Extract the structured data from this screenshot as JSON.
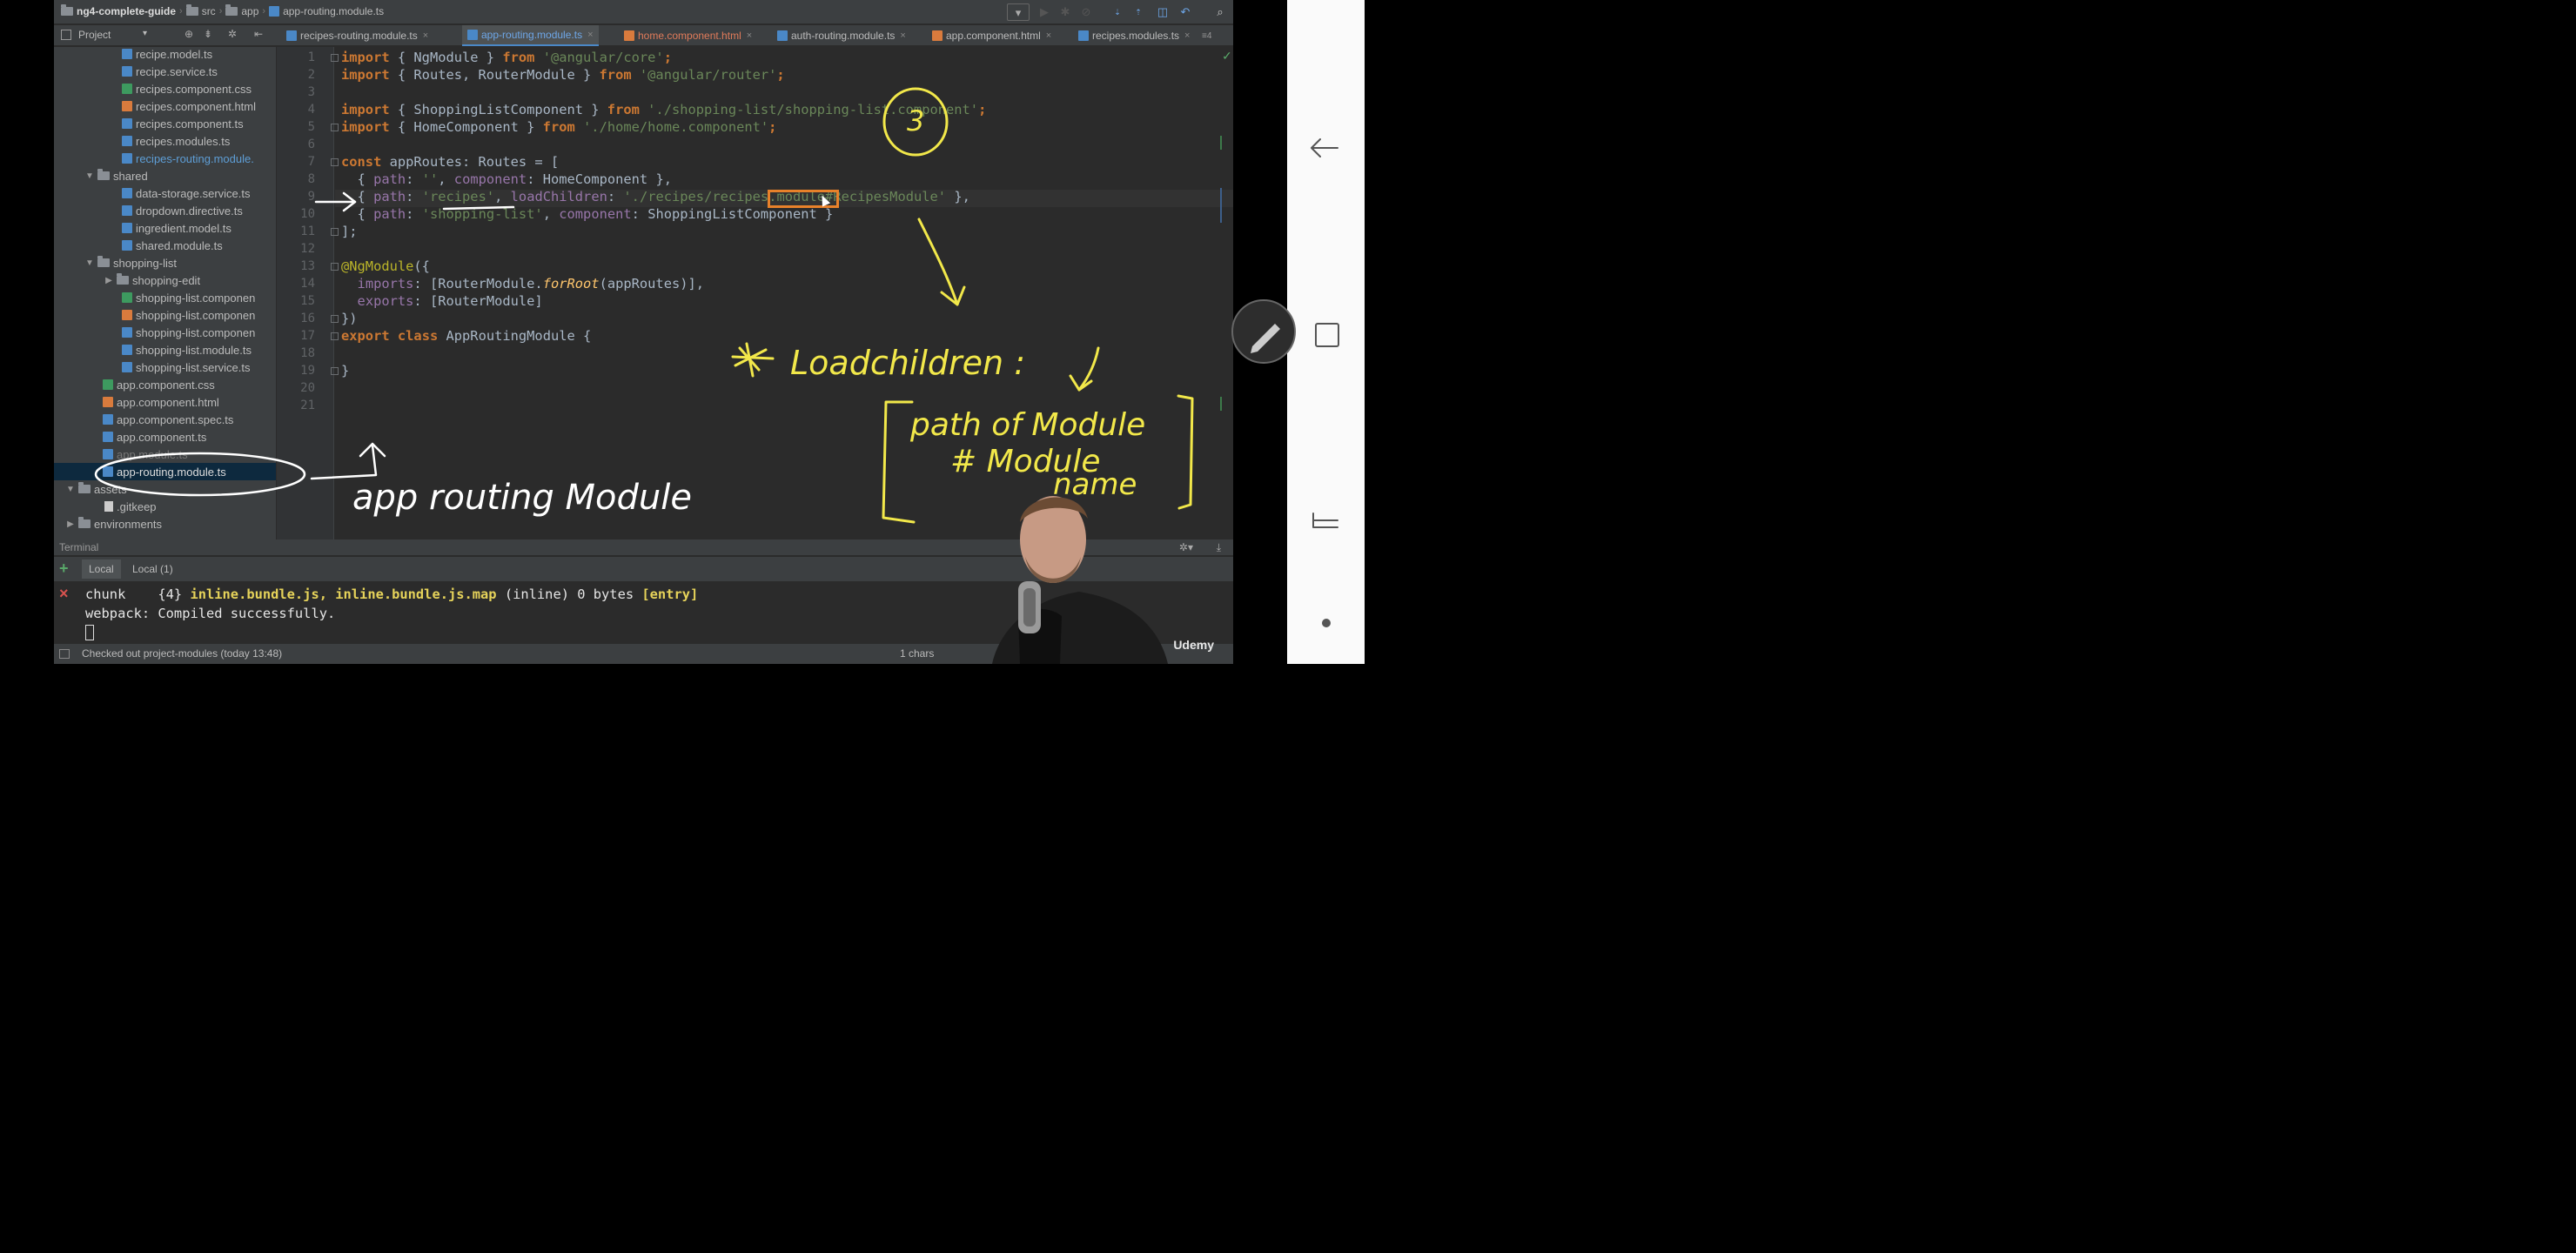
{
  "breadcrumbs": [
    "ng4-complete-guide",
    "src",
    "app",
    "app-routing.module.ts"
  ],
  "project_toolbar": {
    "label": "Project"
  },
  "tabs": [
    {
      "label": "recipes-routing.module.ts",
      "type": "ts"
    },
    {
      "label": "app-routing.module.ts",
      "type": "ts",
      "active": true
    },
    {
      "label": "home.component.html",
      "type": "html"
    },
    {
      "label": "auth-routing.module.ts",
      "type": "ts"
    },
    {
      "label": "app.component.html",
      "type": "html"
    },
    {
      "label": "recipes.modules.ts",
      "type": "ts"
    }
  ],
  "tabs_overflow": "≡4",
  "tree": [
    {
      "label": "recipe.model.ts",
      "type": "ts"
    },
    {
      "label": "recipe.service.ts",
      "type": "ts"
    },
    {
      "label": "recipes.component.css",
      "type": "css"
    },
    {
      "label": "recipes.component.html",
      "type": "html"
    },
    {
      "label": "recipes.component.ts",
      "type": "ts"
    },
    {
      "label": "recipes.modules.ts",
      "type": "ts"
    },
    {
      "label": "recipes-routing.module.",
      "type": "ts"
    },
    {
      "label": "shared",
      "type": "folder"
    },
    {
      "label": "data-storage.service.ts",
      "type": "ts"
    },
    {
      "label": "dropdown.directive.ts",
      "type": "ts"
    },
    {
      "label": "ingredient.model.ts",
      "type": "ts"
    },
    {
      "label": "shared.module.ts",
      "type": "ts"
    },
    {
      "label": "shopping-list",
      "type": "folder"
    },
    {
      "label": "shopping-edit",
      "type": "folder"
    },
    {
      "label": "shopping-list.componen",
      "type": "css"
    },
    {
      "label": "shopping-list.componen",
      "type": "html"
    },
    {
      "label": "shopping-list.componen",
      "type": "ts"
    },
    {
      "label": "shopping-list.module.ts",
      "type": "ts"
    },
    {
      "label": "shopping-list.service.ts",
      "type": "ts"
    },
    {
      "label": "app.component.css",
      "type": "css"
    },
    {
      "label": "app.component.html",
      "type": "html"
    },
    {
      "label": "app.component.spec.ts",
      "type": "ts"
    },
    {
      "label": "app.component.ts",
      "type": "ts"
    },
    {
      "label": "app.module.ts",
      "type": "ts"
    },
    {
      "label": "app-routing.module.ts",
      "type": "ts"
    },
    {
      "label": "assets",
      "type": "folder"
    },
    {
      "label": ".gitkeep",
      "type": "file"
    },
    {
      "label": "environments",
      "type": "folder"
    }
  ],
  "code": {
    "line_numbers": [
      "1",
      "2",
      "3",
      "4",
      "5",
      "6",
      "7",
      "8",
      "9",
      "10",
      "11",
      "12",
      "13",
      "14",
      "15",
      "16",
      "17",
      "18",
      "19",
      "20",
      "21"
    ],
    "l1": [
      "import",
      " { NgModule } ",
      "from",
      " ",
      "'@angular/core'",
      ";"
    ],
    "l2": [
      "import",
      " { Routes, RouterModule } ",
      "from",
      " ",
      "'@angular/router'",
      ";"
    ],
    "l4": [
      "import",
      " { ShoppingListComponent } ",
      "from",
      " ",
      "'./shopping-list/shopping-list.component'",
      ";"
    ],
    "l5": [
      "import",
      " { HomeComponent } ",
      "from",
      " ",
      "'./home/home.component'",
      ";"
    ],
    "l7": [
      "const",
      " appRoutes: Routes = ["
    ],
    "l8": [
      "  { ",
      "path",
      ": ",
      "''",
      ", ",
      "component",
      ": HomeComponent },"
    ],
    "l9": [
      "  { ",
      "path",
      ": ",
      "'recipes'",
      ", ",
      "loadChildren",
      ": ",
      "'./recipes/recipes.module#RecipesModule'",
      " },"
    ],
    "l10": [
      "  { ",
      "path",
      ": ",
      "'shopping-list'",
      ", ",
      "component",
      ": ShoppingListComponent }"
    ],
    "l11": [
      "];"
    ],
    "l13": [
      "@NgModule",
      "({"
    ],
    "l14": [
      "  ",
      "imports",
      ": [RouterModule.",
      "forRoot",
      "(appRoutes)],"
    ],
    "l15": [
      "  ",
      "exports",
      ": [RouterModule]"
    ],
    "l16": [
      "})"
    ],
    "l17": [
      "export",
      " ",
      "class",
      " AppRoutingModule {"
    ],
    "l19": [
      "}"
    ]
  },
  "terminal": {
    "header": "Terminal",
    "tabs": [
      "Local",
      "Local (1)"
    ],
    "line1_parts": [
      "chunk    {4} ",
      "inline.bundle.js, inline.bundle.js.map",
      " (inline) 0 bytes ",
      "[entry]"
    ],
    "line2": "webpack: Compiled successfully."
  },
  "status": {
    "left": "Checked out project-modules (today 13:48)",
    "right": "1 chars"
  },
  "annotations": {
    "circle_number": "3",
    "load_children_note": "Loadchildren : ",
    "bracket_line1": "path of Module",
    "bracket_line2": "# Module",
    "bracket_line3": "name",
    "app_routing_note": "app routing Module"
  },
  "watermark": "Udemy",
  "colors": {
    "annotation": "#f2e84a",
    "annotation_white": "#ffffff",
    "highlight_box": "#e8812a",
    "accent_blue": "#4a88c7"
  }
}
